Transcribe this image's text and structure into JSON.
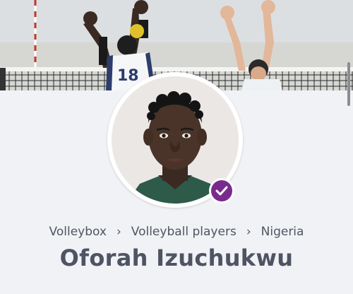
{
  "cover": {
    "jersey_number": "18"
  },
  "profile": {
    "name": "Oforah Izuchukwu",
    "verified": true
  },
  "breadcrumb": {
    "items": [
      "Volleybox",
      "Volleyball players",
      "Nigeria"
    ],
    "separator": "›"
  },
  "colors": {
    "accent": "#7a2a8c",
    "title_text": "#4f5463",
    "breadcrumb_text": "#4f5560",
    "background": "#f0f2f6"
  },
  "icons": {
    "verified": "check-icon",
    "separator": "chevron-right-icon"
  }
}
